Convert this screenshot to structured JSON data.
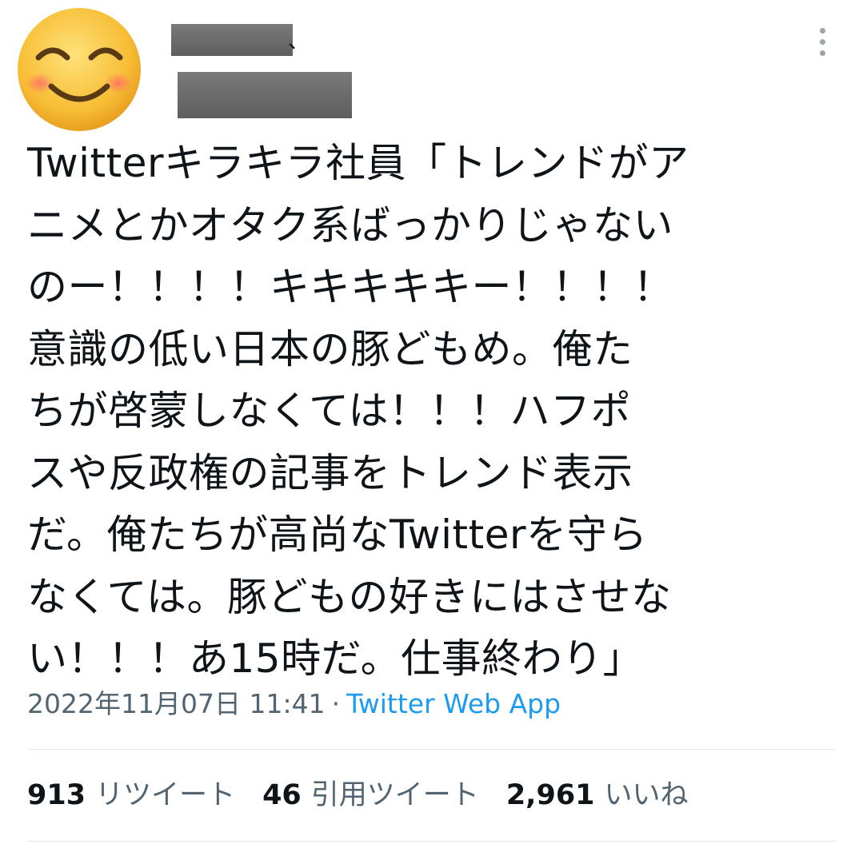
{
  "author": {
    "avatar_icon": "smiling-face-emoji-icon",
    "name_suffix": "、"
  },
  "tweet": {
    "lines": [
      "Twitterキラキラ社員「トレンドがア",
      "ニメとかオタク系ばっかりじゃない",
      "のー！！！！キキキキキー！！！！",
      "意識の低い日本の豚どもめ。俺た",
      "ちが啓蒙しなくては！！！ハフポ",
      "スや反政権の記事をトレンド表示",
      "だ。俺たちが高尚なTwitterを守ら",
      "なくては。豚どもの好きにはさせな",
      "い！！！あ15時だ。仕事終わり」"
    ]
  },
  "meta": {
    "timestamp": "2022年11月07日 11:41",
    "separator": "·",
    "source": "Twitter Web App"
  },
  "stats": {
    "retweets_count": "913",
    "retweets_label": "リツイート",
    "quotes_count": "46",
    "quotes_label": "引用ツイート",
    "likes_count": "2,961",
    "likes_label": "いいね"
  },
  "colors": {
    "text": "#0f1419",
    "secondary": "#536471",
    "link": "#1d9bf0",
    "redaction": "#6b6b6b"
  }
}
